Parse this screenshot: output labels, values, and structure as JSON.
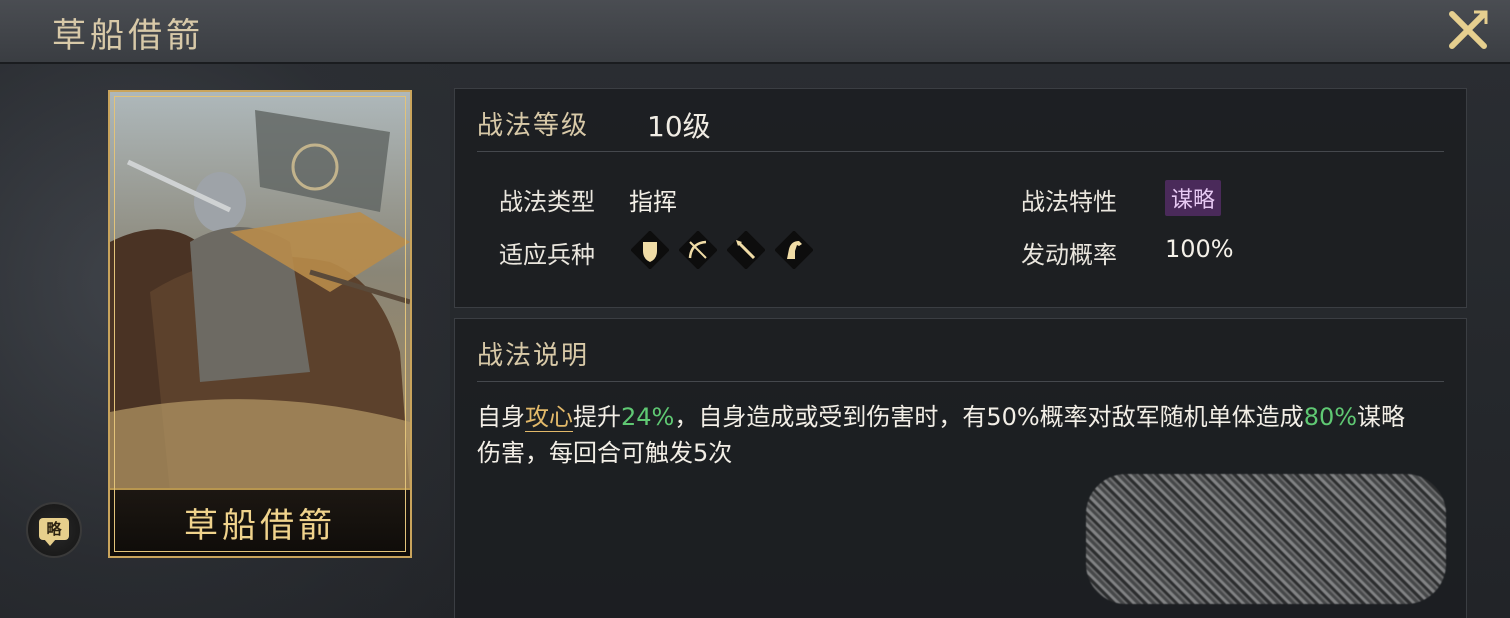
{
  "window": {
    "title": "草船借箭"
  },
  "card": {
    "name": "草船借箭",
    "type_badge": "略"
  },
  "level": {
    "label": "战法等级",
    "value": "10级"
  },
  "attributes": {
    "type_label": "战法类型",
    "type_value": "指挥",
    "trait_label": "战法特性",
    "trait_value": "谋略",
    "troops_label": "适应兵种",
    "troops": [
      "shield-icon",
      "bow-icon",
      "spear-icon",
      "horse-icon"
    ],
    "rate_label": "发动概率",
    "rate_value": "100%"
  },
  "description": {
    "label": "战法说明",
    "t1": "自身",
    "k1": "攻心",
    "t2": "提升",
    "v1": "24%",
    "t3": "，自身造成或受到伤害时，有50%概率对敌军随机单体造成",
    "v2": "80%",
    "t4": "谋略伤害，每回合可触发5次"
  },
  "colors": {
    "accent_gold": "#c9a45c",
    "highlight_green": "#5fc873",
    "highlight_gold": "#e2b96a",
    "trait_purple": "#4a2a5a"
  }
}
